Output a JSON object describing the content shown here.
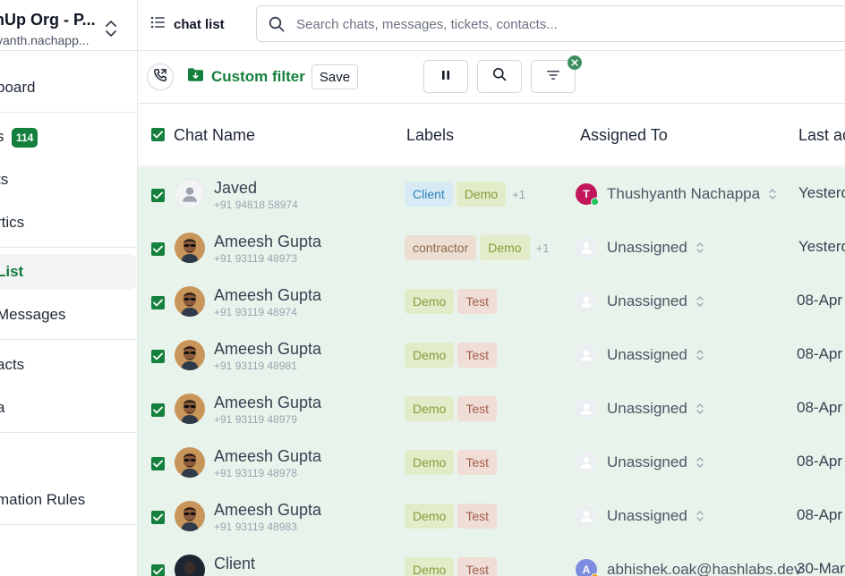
{
  "sidebar": {
    "org_name": "nUp Org - P...",
    "org_email": "yanth.nachapp...",
    "items": [
      {
        "label": "board"
      },
      {
        "label": "s",
        "badge": "114"
      },
      {
        "label": "ts"
      },
      {
        "label": "rtics"
      },
      {
        "label": "List"
      },
      {
        "label": "Messages"
      },
      {
        "label": "acts"
      },
      {
        "label": "a"
      },
      {
        "label": "mation Rules"
      }
    ]
  },
  "topbar": {
    "title": "chat list",
    "search_placeholder": "Search chats, messages, tickets, contacts..."
  },
  "toolbar": {
    "filter_name": "Custom filter",
    "save_label": "Save"
  },
  "table": {
    "columns": [
      "Chat Name",
      "Labels",
      "Assigned To",
      "Last ac"
    ],
    "rows": [
      {
        "name": "Javed",
        "phone": "+91 94818 58974",
        "avatar": "placeholder",
        "labels": [
          {
            "text": "Client",
            "color": "#2d7fb6",
            "bg": "#d8ebf5"
          },
          {
            "text": "Demo",
            "color": "#8a9b3a",
            "bg": "#e2ecc9"
          }
        ],
        "more": "+1",
        "assignee": "Thushyanth Nachappa",
        "assignee_initial": "T",
        "assignee_color": "#c2185b",
        "last": "Yesterd"
      },
      {
        "name": "Ameesh Gupta",
        "phone": "+91 93119 48973",
        "avatar": "photo",
        "labels": [
          {
            "text": "contractor",
            "color": "#8f6a4d",
            "bg": "#ecdfd2"
          },
          {
            "text": "Demo",
            "color": "#8a9b3a",
            "bg": "#e2ecc9"
          }
        ],
        "more": "+1",
        "assignee": "Unassigned",
        "last": "Yesterd"
      },
      {
        "name": "Ameesh Gupta",
        "phone": "+91 93119 48974",
        "avatar": "photo",
        "labels": [
          {
            "text": "Demo",
            "color": "#8a9b3a",
            "bg": "#e2ecc9"
          },
          {
            "text": "Test",
            "color": "#a35f4e",
            "bg": "#f0ddd6"
          }
        ],
        "more": "",
        "assignee": "Unassigned",
        "last": "08-Apr"
      },
      {
        "name": "Ameesh Gupta",
        "phone": "+91 93119 48981",
        "avatar": "photo",
        "labels": [
          {
            "text": "Demo",
            "color": "#8a9b3a",
            "bg": "#e2ecc9"
          },
          {
            "text": "Test",
            "color": "#a35f4e",
            "bg": "#f0ddd6"
          }
        ],
        "more": "",
        "assignee": "Unassigned",
        "last": "08-Apr"
      },
      {
        "name": "Ameesh Gupta",
        "phone": "+91 93119 48979",
        "avatar": "photo",
        "labels": [
          {
            "text": "Demo",
            "color": "#8a9b3a",
            "bg": "#e2ecc9"
          },
          {
            "text": "Test",
            "color": "#a35f4e",
            "bg": "#f0ddd6"
          }
        ],
        "more": "",
        "assignee": "Unassigned",
        "last": "08-Apr"
      },
      {
        "name": "Ameesh Gupta",
        "phone": "+91 93119 48978",
        "avatar": "photo",
        "labels": [
          {
            "text": "Demo",
            "color": "#8a9b3a",
            "bg": "#e2ecc9"
          },
          {
            "text": "Test",
            "color": "#a35f4e",
            "bg": "#f0ddd6"
          }
        ],
        "more": "",
        "assignee": "Unassigned",
        "last": "08-Apr"
      },
      {
        "name": "Ameesh Gupta",
        "phone": "+91 93119 48983",
        "avatar": "photo",
        "labels": [
          {
            "text": "Demo",
            "color": "#8a9b3a",
            "bg": "#e2ecc9"
          },
          {
            "text": "Test",
            "color": "#a35f4e",
            "bg": "#f0ddd6"
          }
        ],
        "more": "",
        "assignee": "Unassigned",
        "last": "08-Apr"
      },
      {
        "name": "Client",
        "phone": "",
        "avatar": "dark",
        "labels": [
          {
            "text": "Demo",
            "color": "#8a9b3a",
            "bg": "#e2ecc9"
          },
          {
            "text": "Test",
            "color": "#a35f4e",
            "bg": "#f0ddd6"
          }
        ],
        "more": "",
        "assignee": "abhishek.oak@hashlabs.dev",
        "assignee_initial": "A",
        "assignee_color": "#7c8de0",
        "last": "30-Mar"
      }
    ]
  },
  "colors": {
    "brand_green": "#15803d",
    "row_bg": "#e8f3ec"
  }
}
